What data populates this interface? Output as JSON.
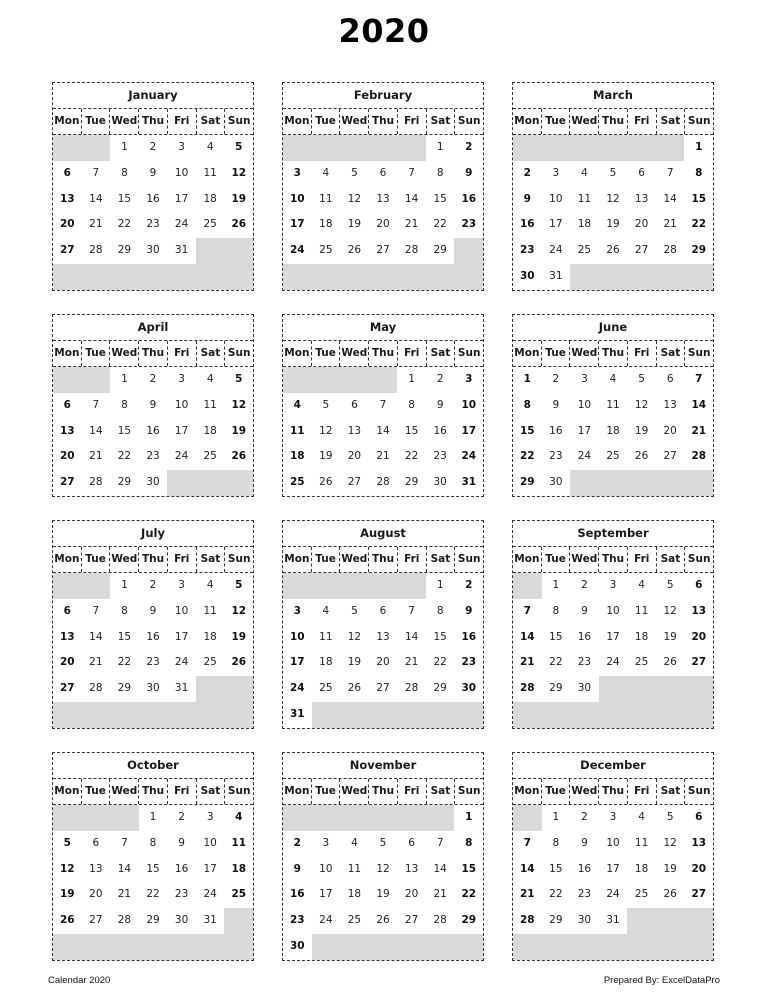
{
  "title": "2020",
  "weekdays": [
    "Mon",
    "Tue",
    "Wed",
    "Thu",
    "Fri",
    "Sat",
    "Sun"
  ],
  "colors": {
    "empty_cell": "#d9d9d9",
    "border": "#333333"
  },
  "months": [
    {
      "name": "January",
      "weeks": [
        [
          null,
          null,
          1,
          2,
          3,
          4,
          5
        ],
        [
          6,
          7,
          8,
          9,
          10,
          11,
          12
        ],
        [
          13,
          14,
          15,
          16,
          17,
          18,
          19
        ],
        [
          20,
          21,
          22,
          23,
          24,
          25,
          26
        ],
        [
          27,
          28,
          29,
          30,
          31,
          null,
          null
        ],
        [
          null,
          null,
          null,
          null,
          null,
          null,
          null
        ]
      ]
    },
    {
      "name": "February",
      "weeks": [
        [
          null,
          null,
          null,
          null,
          null,
          1,
          2
        ],
        [
          3,
          4,
          5,
          6,
          7,
          8,
          9
        ],
        [
          10,
          11,
          12,
          13,
          14,
          15,
          16
        ],
        [
          17,
          18,
          19,
          20,
          21,
          22,
          23
        ],
        [
          24,
          25,
          26,
          27,
          28,
          29,
          null
        ],
        [
          null,
          null,
          null,
          null,
          null,
          null,
          null
        ]
      ]
    },
    {
      "name": "March",
      "weeks": [
        [
          null,
          null,
          null,
          null,
          null,
          null,
          1
        ],
        [
          2,
          3,
          4,
          5,
          6,
          7,
          8
        ],
        [
          9,
          10,
          11,
          12,
          13,
          14,
          15
        ],
        [
          16,
          17,
          18,
          19,
          20,
          21,
          22
        ],
        [
          23,
          24,
          25,
          26,
          27,
          28,
          29
        ],
        [
          30,
          31,
          null,
          null,
          null,
          null,
          null
        ]
      ]
    },
    {
      "name": "April",
      "weeks": [
        [
          null,
          null,
          1,
          2,
          3,
          4,
          5
        ],
        [
          6,
          7,
          8,
          9,
          10,
          11,
          12
        ],
        [
          13,
          14,
          15,
          16,
          17,
          18,
          19
        ],
        [
          20,
          21,
          22,
          23,
          24,
          25,
          26
        ],
        [
          27,
          28,
          29,
          30,
          null,
          null,
          null
        ]
      ]
    },
    {
      "name": "May",
      "weeks": [
        [
          null,
          null,
          null,
          null,
          1,
          2,
          3
        ],
        [
          4,
          5,
          6,
          7,
          8,
          9,
          10
        ],
        [
          11,
          12,
          13,
          14,
          15,
          16,
          17
        ],
        [
          18,
          19,
          20,
          21,
          22,
          23,
          24
        ],
        [
          25,
          26,
          27,
          28,
          29,
          30,
          31
        ]
      ]
    },
    {
      "name": "June",
      "weeks": [
        [
          1,
          2,
          3,
          4,
          5,
          6,
          7
        ],
        [
          8,
          9,
          10,
          11,
          12,
          13,
          14
        ],
        [
          15,
          16,
          17,
          18,
          19,
          20,
          21
        ],
        [
          22,
          23,
          24,
          25,
          26,
          27,
          28
        ],
        [
          29,
          30,
          null,
          null,
          null,
          null,
          null
        ]
      ]
    },
    {
      "name": "July",
      "weeks": [
        [
          null,
          null,
          1,
          2,
          3,
          4,
          5
        ],
        [
          6,
          7,
          8,
          9,
          10,
          11,
          12
        ],
        [
          13,
          14,
          15,
          16,
          17,
          18,
          19
        ],
        [
          20,
          21,
          22,
          23,
          24,
          25,
          26
        ],
        [
          27,
          28,
          29,
          30,
          31,
          null,
          null
        ],
        [
          null,
          null,
          null,
          null,
          null,
          null,
          null
        ]
      ]
    },
    {
      "name": "August",
      "weeks": [
        [
          null,
          null,
          null,
          null,
          null,
          1,
          2
        ],
        [
          3,
          4,
          5,
          6,
          7,
          8,
          9
        ],
        [
          10,
          11,
          12,
          13,
          14,
          15,
          16
        ],
        [
          17,
          18,
          19,
          20,
          21,
          22,
          23
        ],
        [
          24,
          25,
          26,
          27,
          28,
          29,
          30
        ],
        [
          31,
          null,
          null,
          null,
          null,
          null,
          null
        ]
      ]
    },
    {
      "name": "September",
      "weeks": [
        [
          null,
          1,
          2,
          3,
          4,
          5,
          6
        ],
        [
          7,
          8,
          9,
          10,
          11,
          12,
          13
        ],
        [
          14,
          15,
          16,
          17,
          18,
          19,
          20
        ],
        [
          21,
          22,
          23,
          24,
          25,
          26,
          27
        ],
        [
          28,
          29,
          30,
          null,
          null,
          null,
          null
        ],
        [
          null,
          null,
          null,
          null,
          null,
          null,
          null
        ]
      ]
    },
    {
      "name": "October",
      "weeks": [
        [
          null,
          null,
          null,
          1,
          2,
          3,
          4
        ],
        [
          5,
          6,
          7,
          8,
          9,
          10,
          11
        ],
        [
          12,
          13,
          14,
          15,
          16,
          17,
          18
        ],
        [
          19,
          20,
          21,
          22,
          23,
          24,
          25
        ],
        [
          26,
          27,
          28,
          29,
          30,
          31,
          null
        ],
        [
          null,
          null,
          null,
          null,
          null,
          null,
          null
        ]
      ]
    },
    {
      "name": "November",
      "weeks": [
        [
          null,
          null,
          null,
          null,
          null,
          null,
          1
        ],
        [
          2,
          3,
          4,
          5,
          6,
          7,
          8
        ],
        [
          9,
          10,
          11,
          12,
          13,
          14,
          15
        ],
        [
          16,
          17,
          18,
          19,
          20,
          21,
          22
        ],
        [
          23,
          24,
          25,
          26,
          27,
          28,
          29
        ],
        [
          30,
          null,
          null,
          null,
          null,
          null,
          null
        ]
      ]
    },
    {
      "name": "December",
      "weeks": [
        [
          null,
          1,
          2,
          3,
          4,
          5,
          6
        ],
        [
          7,
          8,
          9,
          10,
          11,
          12,
          13
        ],
        [
          14,
          15,
          16,
          17,
          18,
          19,
          20
        ],
        [
          21,
          22,
          23,
          24,
          25,
          26,
          27
        ],
        [
          28,
          29,
          30,
          31,
          null,
          null,
          null
        ],
        [
          null,
          null,
          null,
          null,
          null,
          null,
          null
        ]
      ]
    }
  ],
  "footer": {
    "left": "Calendar 2020",
    "right": "Prepared By: ExcelDataPro"
  }
}
